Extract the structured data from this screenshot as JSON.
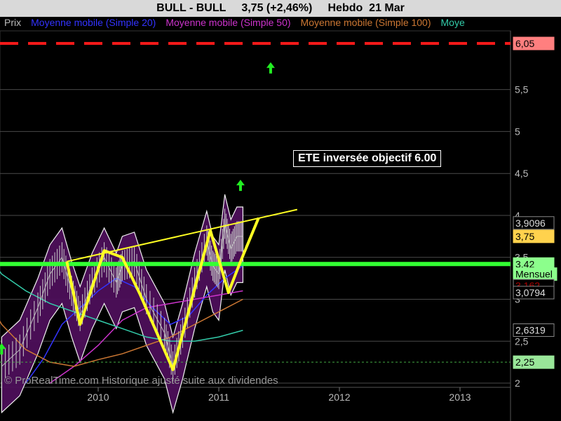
{
  "header": {
    "title": "BULL - BULL     3,75 (+2,46%)     Hebdo  21 Mar"
  },
  "legend": [
    {
      "label": "Prix",
      "color": "#bbbbbb"
    },
    {
      "label": "Moyenne mobile (Simple 20)",
      "color": "#3333ff"
    },
    {
      "label": "Moyenne mobile (Simple 50)",
      "color": "#cc33cc"
    },
    {
      "label": "Moyenne mobile (Simple 100)",
      "color": "#cc7733"
    },
    {
      "label": "Moye",
      "color": "#33ccaa"
    }
  ],
  "annotation": "ETE  inversée objectif 6.00",
  "footer": "© ProRealTime.com Historique ajusté suite aux dividendes",
  "chart_data": {
    "type": "line",
    "title": "BULL - BULL",
    "y_ticks": [
      "5,5",
      "5",
      "4,5",
      "4",
      "3,5",
      "3",
      "2,5",
      "2"
    ],
    "x_ticks": [
      "2010",
      "2011",
      "2012",
      "2013"
    ],
    "ylim": [
      1.95,
      6.2
    ],
    "price_labels": [
      {
        "text": "6,05",
        "value": 6.05,
        "bg": "#ff7f7f",
        "fg": "#000000"
      },
      {
        "text": "3,9096",
        "value": 3.9096,
        "bg": "#000000",
        "fg": "#dddddd"
      },
      {
        "text": "3,75",
        "value": 3.75,
        "bg": "#ffd24d",
        "fg": "#000000"
      },
      {
        "text": "3,42",
        "value": 3.42,
        "bg": "#8cff8c",
        "fg": "#000000"
      },
      {
        "text": "Mensuel",
        "value": 3.3,
        "bg": "#8cff8c",
        "fg": "#000000"
      },
      {
        "text": "3,162",
        "value": 3.162,
        "bg": "#000000",
        "fg": "#aa0000"
      },
      {
        "text": "3,0794",
        "value": 3.0794,
        "bg": "#000000",
        "fg": "#dddddd"
      },
      {
        "text": "2,6319",
        "value": 2.6319,
        "bg": "#000000",
        "fg": "#dddddd"
      },
      {
        "text": "2,25",
        "value": 2.25,
        "bg": "#99e699",
        "fg": "#000000"
      }
    ],
    "resistance_level": 6.05,
    "neckline_support": 3.42,
    "lower_dotted": 2.25,
    "date_range": [
      "2009-03",
      "2011-03"
    ],
    "series": [
      {
        "name": "Prix",
        "color": "#bbbbbb",
        "points": [
          [
            2009.2,
            2.2
          ],
          [
            2009.35,
            2.4
          ],
          [
            2009.5,
            2.9
          ],
          [
            2009.6,
            3.3
          ],
          [
            2009.7,
            3.5
          ],
          [
            2009.78,
            3.1
          ],
          [
            2009.85,
            2.8
          ],
          [
            2009.95,
            3.2
          ],
          [
            2010.05,
            3.5
          ],
          [
            2010.15,
            3.2
          ],
          [
            2010.2,
            3.4
          ],
          [
            2010.3,
            3.45
          ],
          [
            2010.4,
            3.0
          ],
          [
            2010.55,
            2.6
          ],
          [
            2010.62,
            2.2
          ],
          [
            2010.7,
            2.6
          ],
          [
            2010.8,
            3.2
          ],
          [
            2010.9,
            3.7
          ],
          [
            2010.95,
            3.4
          ],
          [
            2011.0,
            3.3
          ],
          [
            2011.05,
            3.9
          ],
          [
            2011.1,
            3.6
          ],
          [
            2011.15,
            3.75
          ],
          [
            2011.2,
            3.75
          ]
        ]
      },
      {
        "name": "Moyenne mobile (Simple 20)",
        "color": "#3333ff",
        "points": [
          [
            2009.4,
            2.0
          ],
          [
            2009.55,
            2.3
          ],
          [
            2009.7,
            2.7
          ],
          [
            2009.85,
            2.9
          ],
          [
            2010.0,
            3.1
          ],
          [
            2010.15,
            3.25
          ],
          [
            2010.3,
            3.15
          ],
          [
            2010.45,
            2.9
          ],
          [
            2010.6,
            2.7
          ],
          [
            2010.75,
            2.8
          ],
          [
            2010.9,
            3.05
          ],
          [
            2011.05,
            3.25
          ],
          [
            2011.2,
            3.4
          ]
        ]
      },
      {
        "name": "Moyenne mobile (Simple 50)",
        "color": "#cc33cc",
        "points": [
          [
            2009.6,
            2.0
          ],
          [
            2009.8,
            2.2
          ],
          [
            2010.0,
            2.45
          ],
          [
            2010.2,
            2.75
          ],
          [
            2010.4,
            2.9
          ],
          [
            2010.6,
            2.95
          ],
          [
            2010.8,
            3.0
          ],
          [
            2011.0,
            3.05
          ],
          [
            2011.2,
            3.1
          ]
        ]
      },
      {
        "name": "Moyenne mobile (Simple 100)",
        "color": "#cc7733",
        "points": [
          [
            2009.0,
            3.2
          ],
          [
            2009.2,
            2.7
          ],
          [
            2009.4,
            2.4
          ],
          [
            2009.6,
            2.25
          ],
          [
            2009.8,
            2.2
          ],
          [
            2010.0,
            2.28
          ],
          [
            2010.2,
            2.35
          ],
          [
            2010.4,
            2.45
          ],
          [
            2010.6,
            2.55
          ],
          [
            2010.8,
            2.7
          ],
          [
            2011.0,
            2.85
          ],
          [
            2011.2,
            3.0
          ]
        ]
      },
      {
        "name": "Moye",
        "color": "#33ccaa",
        "points": [
          [
            2009.0,
            3.7
          ],
          [
            2009.2,
            3.3
          ],
          [
            2009.4,
            3.1
          ],
          [
            2009.6,
            2.95
          ],
          [
            2009.8,
            2.85
          ],
          [
            2010.0,
            2.75
          ],
          [
            2010.2,
            2.65
          ],
          [
            2010.4,
            2.55
          ],
          [
            2010.6,
            2.5
          ],
          [
            2010.8,
            2.5
          ],
          [
            2011.0,
            2.55
          ],
          [
            2011.2,
            2.63
          ]
        ]
      }
    ],
    "pattern_line": [
      [
        2009.74,
        3.45
      ],
      [
        2009.85,
        2.7
      ],
      [
        2010.05,
        3.58
      ],
      [
        2010.2,
        3.5
      ],
      [
        2010.35,
        3.05
      ],
      [
        2010.62,
        2.16
      ],
      [
        2010.93,
        3.82
      ],
      [
        2011.08,
        3.08
      ],
      [
        2011.18,
        3.45
      ],
      [
        2011.33,
        3.97
      ]
    ],
    "trendline": [
      [
        2009.74,
        3.45
      ],
      [
        2011.65,
        4.07
      ]
    ],
    "up_arrows": [
      [
        2009.2,
        2.4
      ],
      [
        2011.18,
        4.35
      ],
      [
        2011.43,
        5.75
      ]
    ]
  }
}
